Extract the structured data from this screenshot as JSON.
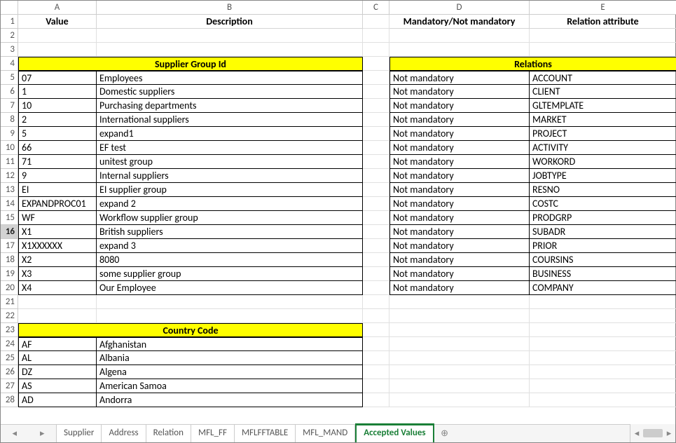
{
  "columns": [
    "A",
    "B",
    "C",
    "D",
    "E"
  ],
  "headers": {
    "A": "Value",
    "B": "Description",
    "D": "Mandatory/Not mandatory",
    "E": "Relation attribute"
  },
  "sections": {
    "supplier_group_id": "Supplier Group Id",
    "relations": "Relations",
    "country_code": "Country Code"
  },
  "supplier_group": [
    {
      "value": "07",
      "desc": "Employees"
    },
    {
      "value": "1",
      "desc": "Domestic suppliers"
    },
    {
      "value": "10",
      "desc": "Purchasing departments"
    },
    {
      "value": "2",
      "desc": "International suppliers"
    },
    {
      "value": "5",
      "desc": "expand1"
    },
    {
      "value": "66",
      "desc": "EF test"
    },
    {
      "value": "71",
      "desc": "unitest group"
    },
    {
      "value": "9",
      "desc": "Internal suppliers"
    },
    {
      "value": "EI",
      "desc": "EI supplier group"
    },
    {
      "value": "EXPANDPROC01",
      "desc": "expand 2"
    },
    {
      "value": "WF",
      "desc": "Workflow supplier group"
    },
    {
      "value": "X1",
      "desc": "British suppliers"
    },
    {
      "value": "X1XXXXXX",
      "desc": "expand 3"
    },
    {
      "value": "X2",
      "desc": "8080"
    },
    {
      "value": "X3",
      "desc": "some supplier group"
    },
    {
      "value": "X4",
      "desc": "Our Employee"
    }
  ],
  "relations": [
    {
      "mand": "Not mandatory",
      "attr": "ACCOUNT"
    },
    {
      "mand": "Not mandatory",
      "attr": "CLIENT"
    },
    {
      "mand": "Not mandatory",
      "attr": "GLTEMPLATE"
    },
    {
      "mand": "Not mandatory",
      "attr": "MARKET"
    },
    {
      "mand": "Not mandatory",
      "attr": "PROJECT"
    },
    {
      "mand": "Not mandatory",
      "attr": "ACTIVITY"
    },
    {
      "mand": "Not mandatory",
      "attr": "WORKORD"
    },
    {
      "mand": "Not mandatory",
      "attr": "JOBTYPE"
    },
    {
      "mand": "Not mandatory",
      "attr": "RESNO"
    },
    {
      "mand": "Not mandatory",
      "attr": "COSTC"
    },
    {
      "mand": "Not mandatory",
      "attr": "PRODGRP"
    },
    {
      "mand": "Not mandatory",
      "attr": "SUBADR"
    },
    {
      "mand": "Not mandatory",
      "attr": "PRIOR"
    },
    {
      "mand": "Not mandatory",
      "attr": "COURSINS"
    },
    {
      "mand": "Not mandatory",
      "attr": "BUSINESS"
    },
    {
      "mand": "Not mandatory",
      "attr": "COMPANY"
    }
  ],
  "country_codes": [
    {
      "value": "AF",
      "desc": "Afghanistan"
    },
    {
      "value": "AL",
      "desc": "Albania"
    },
    {
      "value": "DZ",
      "desc": "Algena"
    },
    {
      "value": "AS",
      "desc": "American Samoa"
    },
    {
      "value": "AD",
      "desc": "Andorra"
    }
  ],
  "tabs": [
    "Supplier",
    "Address",
    "Relation",
    "MFL_FF",
    "MFLFFTABLE",
    "MFL_MAND",
    "Accepted Values"
  ],
  "active_tab": "Accepted Values",
  "selected_row": 16
}
